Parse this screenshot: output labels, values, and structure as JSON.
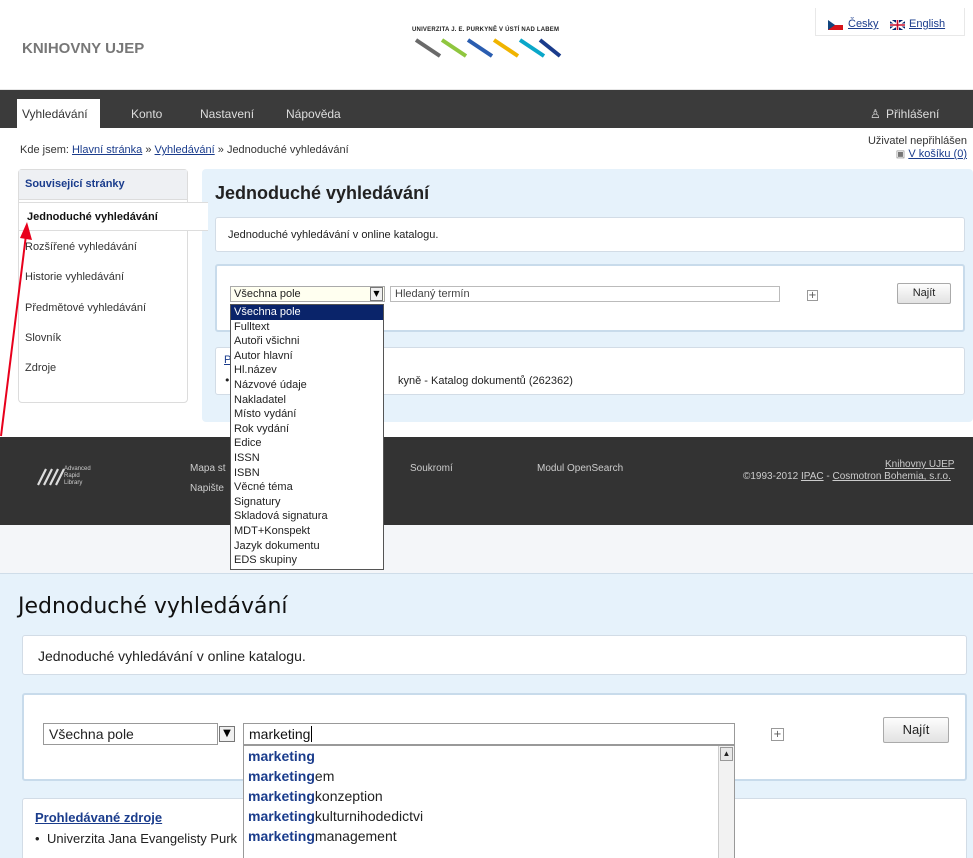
{
  "header": {
    "library_title": "KNIHOVNY UJEP",
    "university_name": "UNIVERZITA J. E. PURKYNĚ V ÚSTÍ NAD LABEM",
    "lang_cz": "Česky",
    "lang_en": "English"
  },
  "nav": {
    "items": [
      "Vyhledávání",
      "Konto",
      "Nastavení",
      "Nápověda"
    ],
    "login": "Přihlášení"
  },
  "breadcrumb": {
    "prefix": "Kde jsem:",
    "home": "Hlavní stránka",
    "sep1": "»",
    "search": "Vyhledávání",
    "sep2": "»",
    "current": "Jednoduché vyhledávání"
  },
  "user": {
    "status": "Uživatel nepřihlášen",
    "cart": "V košíku (0)"
  },
  "sidebar": {
    "heading": "Související stránky",
    "active": "Jednoduché vyhledávání",
    "items": [
      "Rozšířené vyhledávání",
      "Historie vyhledávání",
      "Předmětové vyhledávání",
      "Slovník",
      "Zdroje"
    ]
  },
  "main": {
    "title": "Jednoduché vyhledávání",
    "description": "Jednoduché vyhledávání v online katalogu.",
    "field_select": "Všechna pole",
    "term_placeholder": "Hledaný termín",
    "find": "Najít",
    "sources_head": "P",
    "sources_tail": "kyně - Katalog dokumentů (262362)"
  },
  "dropdown_options": [
    "Všechna pole",
    "Fulltext",
    "Autoři všichni",
    "Autor hlavní",
    "Hl.název",
    "Názvové údaje",
    "Nakladatel",
    "Místo vydání",
    "Rok vydání",
    "Edice",
    "ISSN",
    "ISBN",
    "Věcné téma",
    "Signatury",
    "Skladová signatura",
    "MDT+Konspekt",
    "Jazyk dokumentu",
    "EDS skupiny"
  ],
  "footer": {
    "arl_logo": "Advanced Rapid Library",
    "sitemap": "Mapa st",
    "write": "Napište",
    "privacy": "Soukromí",
    "opensearch": "Modul OpenSearch",
    "library_link": "Knihovny UJEP",
    "copyright": "©1993-2012",
    "ipac": "IPAC",
    "sep": " - ",
    "company": "Cosmotron Bohemia, s.r.o."
  },
  "zoom": {
    "title": "Jednoduché vyhledávání",
    "description": "Jednoduché vyhledávání v online katalogu.",
    "field_select": "Všechna pole",
    "term_value": "marketing",
    "find": "Najít",
    "sources_heading": "Prohledávané zdroje",
    "sources_item": "Univerzita Jana Evangelisty Purk",
    "suggestions": [
      {
        "match": "marketing",
        "rest": ""
      },
      {
        "match": "marketing",
        "rest": "em"
      },
      {
        "match": "marketing",
        "rest": "konzeption"
      },
      {
        "match": "marketing",
        "rest": "kulturnihodedictvi"
      },
      {
        "match": "marketing",
        "rest": "management"
      }
    ]
  },
  "colors": {
    "accent": "#1a3c8c",
    "nav_bg": "#3b3b3b",
    "panel_bg": "#e6f2fb",
    "arrow": "#e8001c"
  }
}
